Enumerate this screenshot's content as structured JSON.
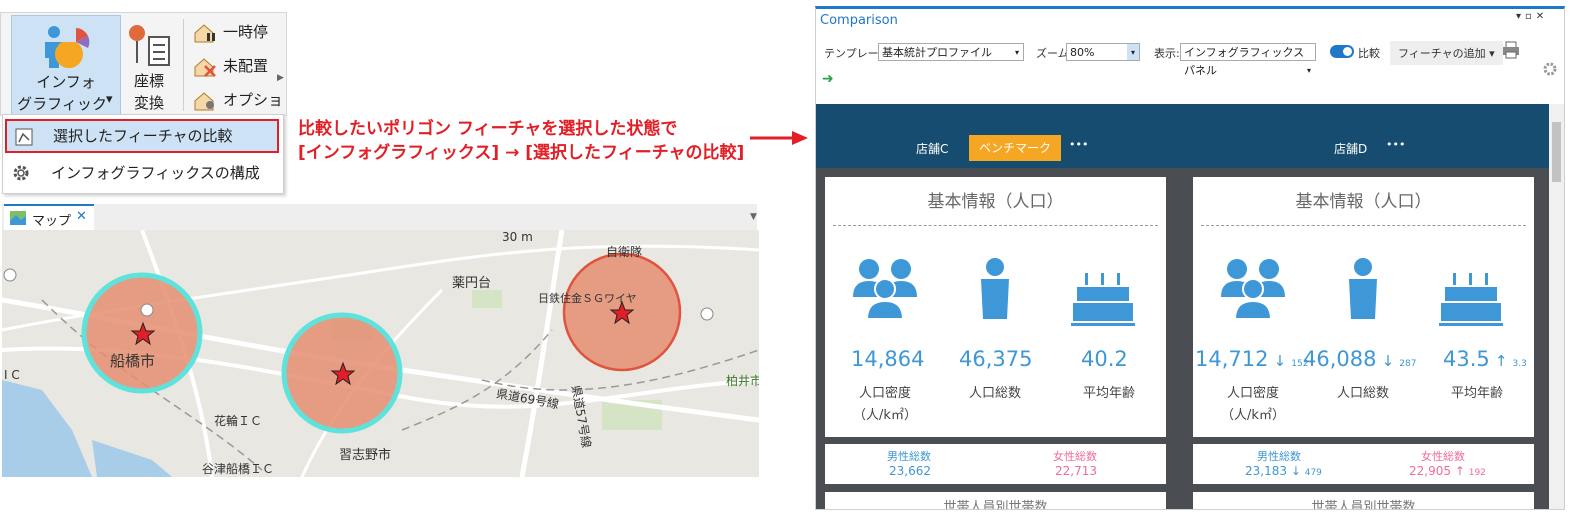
{
  "ribbon": {
    "infographics_line1": "インフォ",
    "infographics_line2": "グラフィックス",
    "dropdown_arrow": "▾",
    "geocode_line1": "座標",
    "geocode_line2": "変換",
    "item_pause": "一時停",
    "item_unplaced": "未配置",
    "item_options": "オプショ"
  },
  "menu": {
    "compare_label": "選択したフィーチャの比較",
    "configure_label": "インフォグラフィックスの構成"
  },
  "annotation": {
    "line1": "比較したいポリゴン フィーチャを選択した状態で",
    "line2": "[インフォグラフィックス] → [選択したフィーチャの比較]"
  },
  "map": {
    "tab_label": "マップ",
    "close": "✕",
    "labels": {
      "scale": "30 m",
      "yakuendai": "薬円台",
      "jieitai": "自衛隊",
      "nittetsu": "日鉄住金ＳＧワイヤ",
      "funabashi": "船橋市",
      "ic": "I C",
      "hanawa": "花輪ＩＣ",
      "kendo69": "県道69号線",
      "kendo57": "県道57号線",
      "narashino": "習志野市",
      "yatsu": "谷津船橋ＩＣ",
      "kashiwai": "柏井市"
    }
  },
  "comparison": {
    "title": "Comparison",
    "template_label": "テンプレート:",
    "template_value": "基本統計プロファイル",
    "zoom_label": "ズーム:",
    "zoom_value": "80%",
    "display_label": "表示:",
    "display_value": "インフォグラフィックス パネル",
    "compare_toggle": "比較",
    "add_feature": "フィーチャの追加 ▾",
    "tabs": {
      "storeC": "店舗C",
      "benchmark": "ベンチマーク",
      "storeD": "店舗D",
      "more": "•••"
    },
    "card_title": "基本情報（人口）",
    "left": {
      "density": "14,864",
      "total": "46,375",
      "age": "40.2",
      "male": "23,662",
      "female": "22,713"
    },
    "right": {
      "density": "14,712",
      "density_delta": "↓",
      "density_delta_val": "152",
      "total": "46,088",
      "total_delta": "↓",
      "total_delta_val": "287",
      "age": "43.5",
      "age_delta": "↑",
      "age_delta_val": "3.3",
      "male": "23,183",
      "male_delta": "↓",
      "male_delta_val": "479",
      "female": "22,905",
      "female_delta": "↑",
      "female_delta_val": "192"
    },
    "captions": {
      "density": "人口密度",
      "density_unit": "（人/k㎡）",
      "total": "人口総数",
      "age": "平均年齢",
      "male": "男性総数",
      "female": "女性総数",
      "household": "世帯人員別世帯数"
    }
  },
  "colors": {
    "accent": "#1f78c8",
    "header": "#164c6f",
    "benchmark": "#f5a623",
    "annotation": "#e21f26",
    "value_blue": "#3e97d6",
    "female_pink": "#ef6c99",
    "buffer_fill": "#e48e71",
    "buffer_outline": "#5ee3dc"
  }
}
